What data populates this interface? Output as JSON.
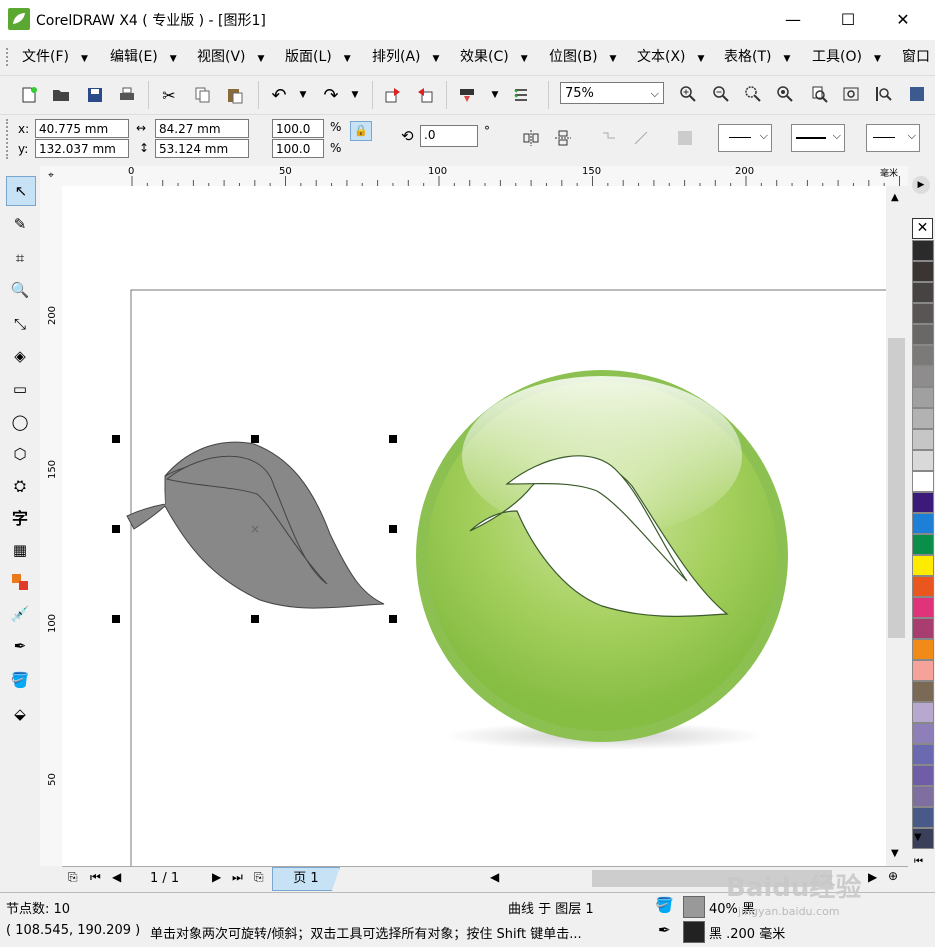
{
  "window": {
    "title": "CorelDRAW X4 ( 专业版 ) - [图形1]",
    "minimize": "—",
    "maximize": "☐",
    "close": "✕"
  },
  "menus": [
    "文件(F)",
    "编辑(E)",
    "视图(V)",
    "版面(L)",
    "排列(A)",
    "效果(C)",
    "位图(B)",
    "文本(X)",
    "表格(T)",
    "工具(O)",
    "窗口"
  ],
  "toolbar": {
    "zoom": "75%"
  },
  "property_bar": {
    "x_label": "x:",
    "x_value": "40.775 mm",
    "y_label": "y:",
    "y_value": "132.037 mm",
    "w_value": "84.27 mm",
    "h_value": "53.124 mm",
    "scale_x": "100.0",
    "scale_y": "100.0",
    "pct": "%",
    "rotation": ".0",
    "degree": "°"
  },
  "ruler": {
    "top_ticks": [
      "0",
      "50",
      "100",
      "150",
      "200"
    ],
    "top_unit": "毫米",
    "left_ticks": [
      "200",
      "150",
      "100",
      "50"
    ]
  },
  "pagebar": {
    "page_count": "1 / 1",
    "page_tab": "页 1"
  },
  "status": {
    "nodes": "节点数: 10",
    "object": "曲线 于 图层 1",
    "fill": "40% 黑",
    "coords": "( 108.545, 190.209 )",
    "hint": "单击对象两次可旋转/倾斜；双击工具可选择所有对象；按住 Shift 键单击...",
    "outline": "黑  .200 毫米"
  },
  "watermark": {
    "text": "Baidu经验",
    "url": "jingyan.baidu.com"
  },
  "palette": [
    "#2b2b2b",
    "#3a3533",
    "#474342",
    "#595555",
    "#6a6767",
    "#7c7979",
    "#8e8c8c",
    "#a1a0a0",
    "#b3b2b2",
    "#c6c6c6",
    "#d9d9d9",
    "#ffffff",
    "#3b1a7a",
    "#1d7fd6",
    "#0a8f4a",
    "#ffeb00",
    "#e9571f",
    "#e0347a",
    "#a83e6f",
    "#f08a18",
    "#f5a29a",
    "#7a6a55",
    "#b6a8cf",
    "#8f7fb8",
    "#6b6ab0",
    "#6f5da8",
    "#7f6fa0",
    "#4a5a88",
    "#3a3f5a"
  ],
  "colors": {
    "leaf_gray": "#888888",
    "circle_green": "#8cc152",
    "accent": "#c7e1f5"
  }
}
